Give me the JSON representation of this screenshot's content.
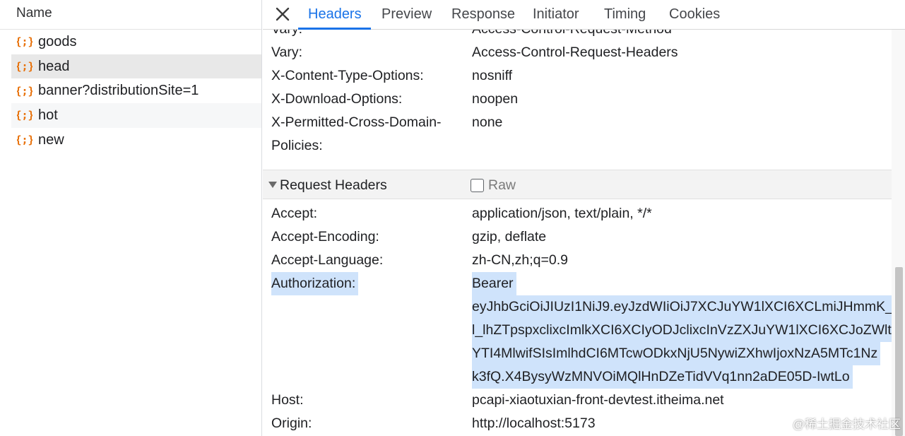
{
  "left": {
    "column_header": "Name",
    "requests": [
      {
        "name": "goods",
        "icon": "json-braces-icon"
      },
      {
        "name": "head",
        "icon": "json-braces-icon"
      },
      {
        "name": "banner?distributionSite=1",
        "icon": "json-braces-icon"
      },
      {
        "name": "hot",
        "icon": "json-braces-icon"
      },
      {
        "name": "new",
        "icon": "json-braces-icon"
      }
    ],
    "selected": "head"
  },
  "tabs": {
    "close_icon": "close-icon",
    "items": [
      "Headers",
      "Preview",
      "Response",
      "Initiator",
      "Timing",
      "Cookies"
    ],
    "active": "Headers",
    "accent_color": "#1a73e8"
  },
  "response_headers": [
    {
      "key": "Vary:",
      "value": "Access-Control-Request-Method"
    },
    {
      "key": "Vary:",
      "value": "Access-Control-Request-Headers"
    },
    {
      "key": "X-Content-Type-Options:",
      "value": "nosniff"
    },
    {
      "key": "X-Download-Options:",
      "value": "noopen"
    },
    {
      "key_line1": "X-Permitted-Cross-Domain-",
      "key_line2": "Policies:",
      "value": "none"
    }
  ],
  "request_section": {
    "title": "Request Headers",
    "raw_label": "Raw",
    "raw_checked": false
  },
  "request_headers": {
    "accept": {
      "key": "Accept:",
      "value": "application/json, text/plain, */*"
    },
    "accept_encoding": {
      "key": "Accept-Encoding:",
      "value": "gzip, deflate"
    },
    "accept_language": {
      "key": "Accept-Language:",
      "value": "zh-CN,zh;q=0.9"
    },
    "authorization": {
      "key": "Authorization:",
      "value_lines": [
        "Bearer",
        "eyJhbGciOiJIUzI1NiJ9.eyJzdWIiOiJ7XCJuYW1lXCI6XCLmiJHmmK_ls",
        "l_lhZTpspxclixcImlkXCI6XCIyODJclixcInVzZXJuYW1lXCI6XCJoZWlt",
        "YTI4MlwifSIsImlhdCI6MTcwODkxNjU5NywiZXhwIjoxNzA5MTc1Nz",
        "k3fQ.X4BysyWzMNVOiMQlHnDZeTidVVq1nn2aDE05D-IwtLo"
      ],
      "selected": true
    },
    "host": {
      "key": "Host:",
      "value": "pcapi-xiaotuxian-front-devtest.itheima.net"
    },
    "origin": {
      "key": "Origin:",
      "value": "http://localhost:5173"
    }
  },
  "watermark": "@稀土掘金技术社区",
  "colors": {
    "selection": "#cfe3fb",
    "icon_orange": "#e8710a"
  }
}
